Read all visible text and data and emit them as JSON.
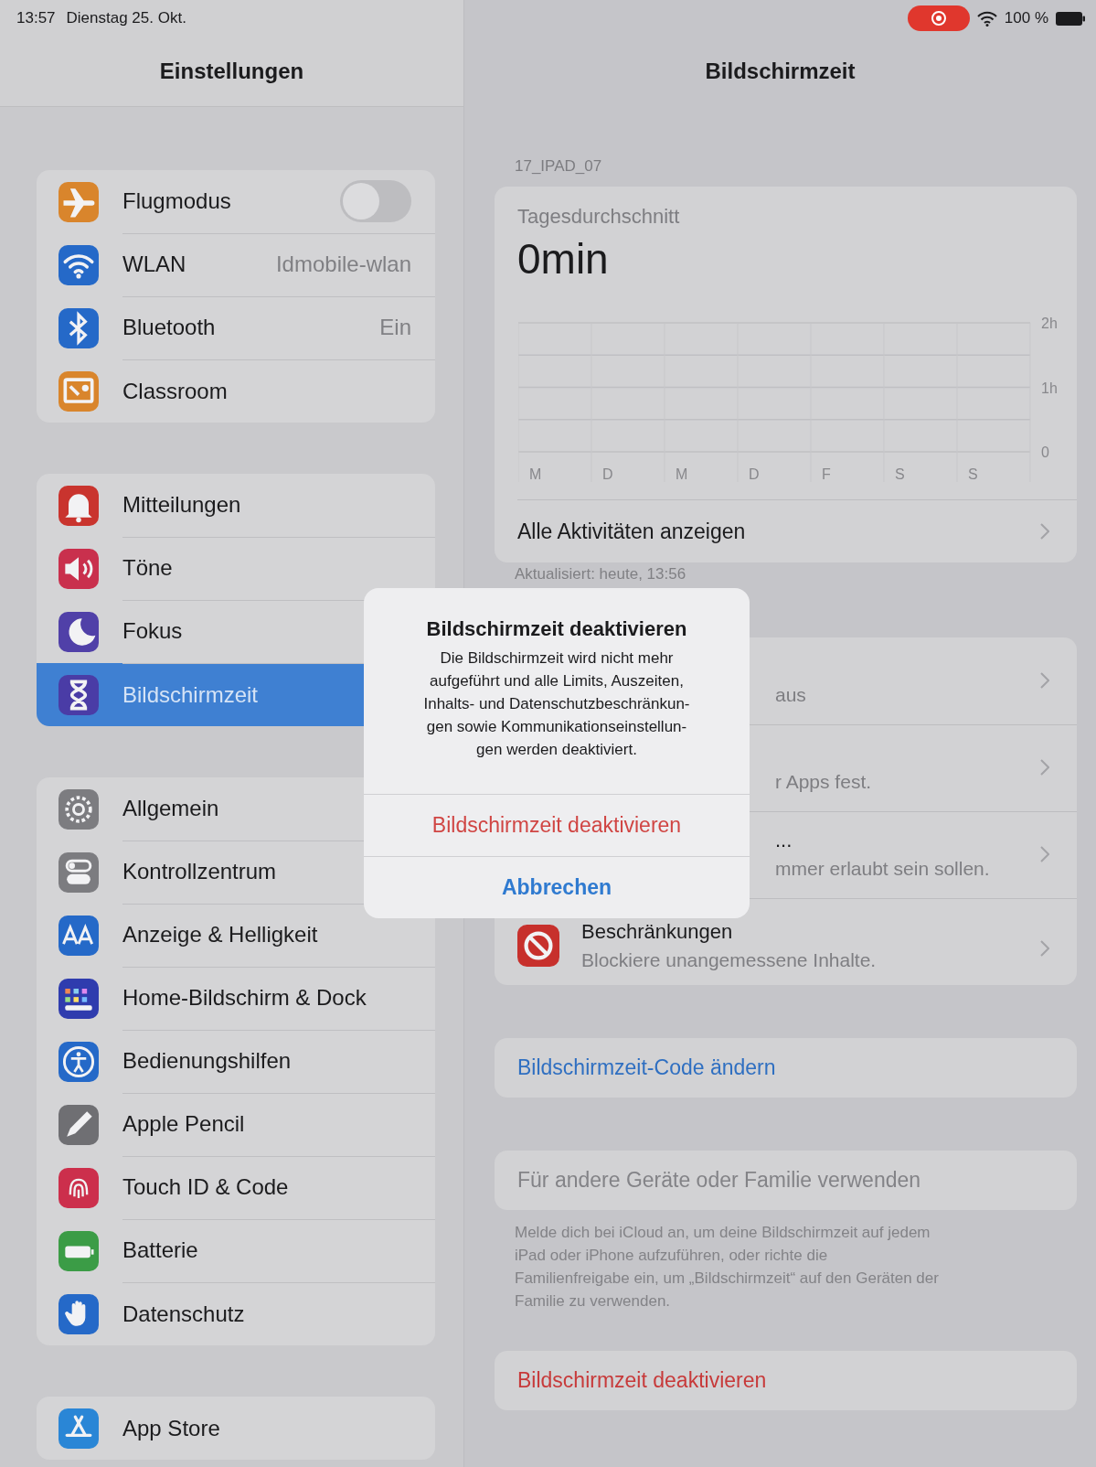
{
  "status_bar": {
    "time": "13:57",
    "date": "Dienstag 25. Okt.",
    "battery": "100 %"
  },
  "sidebar": {
    "title": "Einstellungen",
    "groups": [
      {
        "items": [
          {
            "label": "Flugmodus",
            "switch_on": false,
            "selected": false
          },
          {
            "label": "WLAN",
            "value": "Idmobile-wlan",
            "selected": false
          },
          {
            "label": "Bluetooth",
            "value": "Ein",
            "selected": false
          },
          {
            "label": "Classroom",
            "selected": false
          }
        ]
      },
      {
        "items": [
          {
            "label": "Mitteilungen",
            "selected": false
          },
          {
            "label": "Töne",
            "selected": false
          },
          {
            "label": "Fokus",
            "selected": false
          },
          {
            "label": "Bildschirmzeit",
            "selected": true
          }
        ]
      },
      {
        "items": [
          {
            "label": "Allgemein",
            "selected": false
          },
          {
            "label": "Kontrollzentrum",
            "selected": false
          },
          {
            "label": "Anzeige & Helligkeit",
            "selected": false
          },
          {
            "label": "Home-Bildschirm & Dock",
            "selected": false
          },
          {
            "label": "Bedienungshilfen",
            "selected": false
          },
          {
            "label": "Apple Pencil",
            "selected": false
          },
          {
            "label": "Touch ID & Code",
            "selected": false
          },
          {
            "label": "Batterie",
            "selected": false
          },
          {
            "label": "Datenschutz",
            "selected": false
          }
        ]
      },
      {
        "items": [
          {
            "label": "App Store",
            "selected": false
          }
        ]
      }
    ]
  },
  "detail": {
    "title": "Bildschirmzeit",
    "device": "17_IPAD_07",
    "summary": {
      "label": "Tagesdurchschnitt",
      "value": "0min",
      "link": "Alle Aktivitäten anzeigen",
      "chart_data": {
        "type": "bar",
        "categories": [
          "M",
          "D",
          "M",
          "D",
          "F",
          "S",
          "S"
        ],
        "values": [
          0,
          0,
          0,
          0,
          0,
          0,
          0
        ],
        "ylim": [
          0,
          2
        ],
        "yticks": [
          {
            "value": 0,
            "label": "0"
          },
          {
            "value": 1,
            "label": "1h"
          },
          {
            "value": 2,
            "label": "2h"
          }
        ]
      }
    },
    "updated": "Aktualisiert: heute, 13:56",
    "options": [
      {
        "kind": "partial",
        "subtitle": "aus"
      },
      {
        "kind": "partial",
        "subtitle": "r Apps fest."
      },
      {
        "kind": "partial",
        "title": "...",
        "subtitle": "mmer erlaubt sein sollen."
      },
      {
        "kind": "full",
        "title": "Beschränkungen",
        "subtitle": "Blockiere unangemessene Inhalte."
      }
    ],
    "code_button": "Bildschirmzeit-Code ändern",
    "family_button": {
      "label": "Für andere Geräte oder Familie verwenden",
      "disabled": true
    },
    "family_note": "Melde dich bei iCloud an, um deine Bildschirmzeit auf jedem\niPad oder iPhone aufzuführen, oder richte die\nFamilienfreigabe ein, um „Bildschirmzeit“ auf den Geräten der\nFamilie zu verwenden.",
    "deactivate_button": "Bildschirmzeit deaktivieren"
  },
  "alert": {
    "title": "Bildschirmzeit deaktivieren",
    "message": "Die Bildschirmzeit wird nicht mehr\naufgeführt und alle Limits, Auszeiten,\nInhalts- und Datenschutzbeschränkun-\ngen sowie Kommunikationseinstellun-\ngen werden deaktiviert.",
    "buttons": [
      {
        "label": "Bildschirmzeit deaktivieren",
        "kind": "destructive"
      },
      {
        "label": "Abbrechen",
        "kind": "cancel"
      }
    ]
  }
}
